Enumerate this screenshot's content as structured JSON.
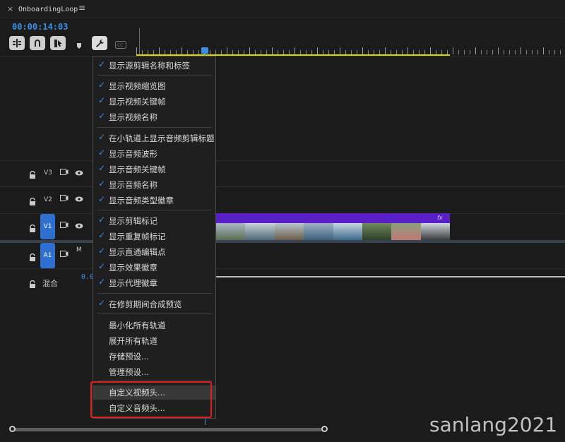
{
  "tab": {
    "close": "×",
    "title": "OnboardingLoop",
    "menu": "≡"
  },
  "timecode": "00:00:14:03",
  "tracks": {
    "v3": "V3",
    "v2": "V2",
    "v1": "V1",
    "a1": "A1",
    "a1_mute": "M",
    "mix_label": "混合",
    "mix_value": "0.0"
  },
  "clip": {
    "fx": "fx"
  },
  "menu": {
    "items": [
      {
        "label": "显示源剪辑名称和标签",
        "checked": "✓"
      },
      {
        "label": "显示视频缩览图",
        "checked": "✓"
      },
      {
        "label": "显示视频关键帧",
        "checked": "✓"
      },
      {
        "label": "显示视频名称",
        "checked": "✓"
      },
      {
        "label": "在小轨道上显示音频剪辑标题",
        "checked": "✓"
      },
      {
        "label": "显示音频波形",
        "checked": "✓"
      },
      {
        "label": "显示音频关键帧",
        "checked": "✓"
      },
      {
        "label": "显示音频名称",
        "checked": "✓"
      },
      {
        "label": "显示音频类型徽章",
        "checked": "✓"
      },
      {
        "label": "显示剪辑标记",
        "checked": "✓"
      },
      {
        "label": "显示重复帧标记",
        "checked": "✓"
      },
      {
        "label": "显示直通编辑点",
        "checked": "✓"
      },
      {
        "label": "显示效果徽章",
        "checked": "✓"
      },
      {
        "label": "显示代理徽章",
        "checked": "✓"
      },
      {
        "label": "在修剪期间合成预览",
        "checked": "✓"
      },
      {
        "label": "最小化所有轨道",
        "checked": ""
      },
      {
        "label": "展开所有轨道",
        "checked": ""
      },
      {
        "label": "存储预设...",
        "checked": ""
      },
      {
        "label": "管理预设...",
        "checked": ""
      },
      {
        "label": "自定义视频头...",
        "checked": ""
      },
      {
        "label": "自定义音频头...",
        "checked": ""
      }
    ]
  },
  "watermark": "sanlang2021",
  "colors": {
    "accent": "#3a8ee6",
    "clip_purple": "#5a1fc7",
    "work_area": "#d8d800",
    "highlight_box": "#e01f1f"
  }
}
